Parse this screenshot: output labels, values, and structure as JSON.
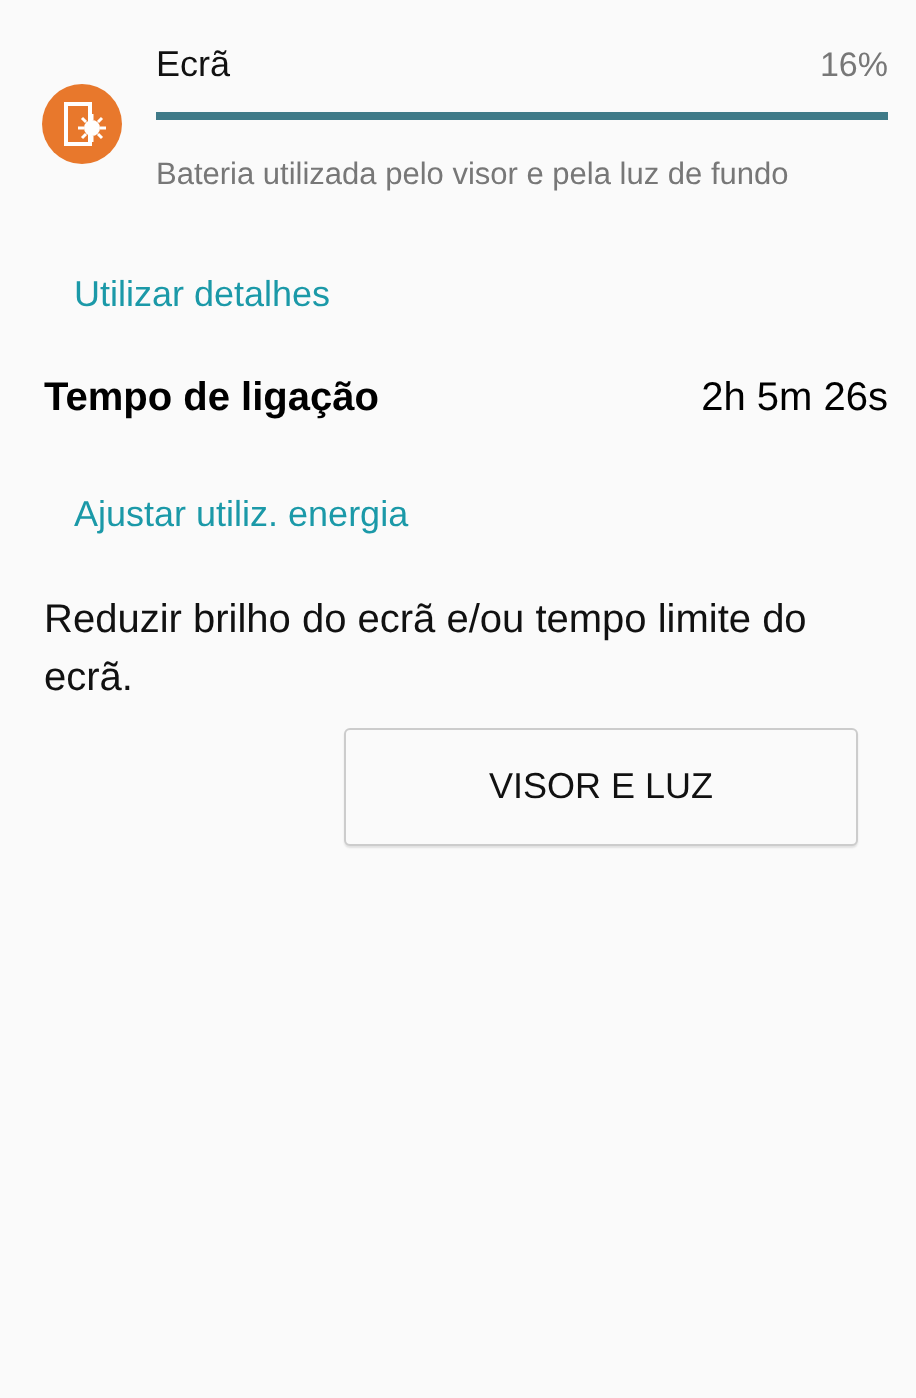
{
  "usage_item": {
    "title": "Ecrã",
    "percent": "16%",
    "level": 1.0,
    "description": "Bateria utilizada pelo visor e pela luz de fundo"
  },
  "details_header": "Utilizar detalhes",
  "details": [
    {
      "label": "Tempo de ligação",
      "value": "2h 5m 26s"
    }
  ],
  "adjust_header": "Ajustar utiliz. energia",
  "tip": "Reduzir brilho do ecrã e/ou tempo limite do ecrã.",
  "action_button": "VISOR E LUZ"
}
